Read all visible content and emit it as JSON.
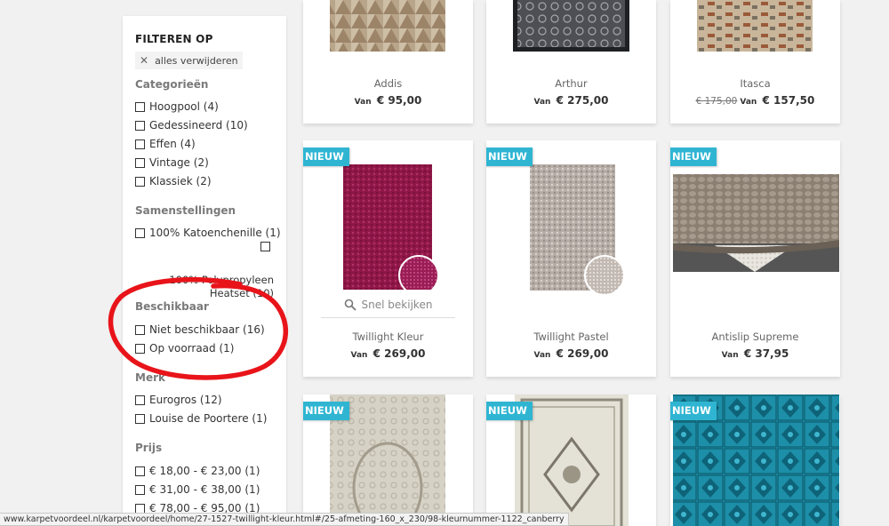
{
  "filters": {
    "title": "FILTEREN OP",
    "clear_all": "alles verwijderen",
    "categories": {
      "title": "Categorieën",
      "options": [
        "Hoogpool (4)",
        "Gedessineerd (10)",
        "Effen (4)",
        "Vintage (2)",
        "Klassiek (2)"
      ]
    },
    "compositions": {
      "title": "Samenstellingen",
      "options": [
        "100% Katoenchenille (1)",
        "100% Polypropyleen Heatset (10)"
      ]
    },
    "availability": {
      "title": "Beschikbaar",
      "options": [
        "Niet beschikbaar (16)",
        "Op voorraad (1)"
      ]
    },
    "brand": {
      "title": "Merk",
      "options": [
        "Eurogros (12)",
        "Louise de Poortere (1)"
      ]
    },
    "price": {
      "title": "Prijs",
      "options": [
        "€ 18,00 - € 23,00 (1)",
        "€ 31,00 - € 38,00 (1)",
        "€ 78,00 - € 95,00 (1)"
      ]
    }
  },
  "products": [
    {
      "name": "Addis",
      "van": "Van",
      "price": "€ 95,00"
    },
    {
      "name": "Arthur",
      "van": "Van",
      "price": "€ 275,00"
    },
    {
      "name": "Itasca",
      "van": "Van",
      "old_price": "€ 175,00",
      "price": "€ 157,50"
    },
    {
      "name": "Twillight Kleur",
      "badge": "NIEUW",
      "van": "Van",
      "price": "€ 269,00",
      "quick_view": "Snel bekijken"
    },
    {
      "name": "Twillight Pastel",
      "badge": "NIEUW",
      "van": "Van",
      "price": "€ 269,00"
    },
    {
      "name": "Antislip Supreme",
      "badge": "NIEUW",
      "van": "Van",
      "price": "€ 37,95"
    },
    {
      "badge": "NIEUW"
    },
    {
      "badge": "NIEUW"
    },
    {
      "badge": "NIEUW"
    }
  ],
  "status_url": "www.karpetvoordeel.nl/karpetvoordeel/home/27-1527-twillight-kleur.html#/25-afmeting-160_x_230/98-kleurnummer-1122_canberry",
  "colors": {
    "badge": "#2fb5d2",
    "annotation": "#e8141a"
  }
}
